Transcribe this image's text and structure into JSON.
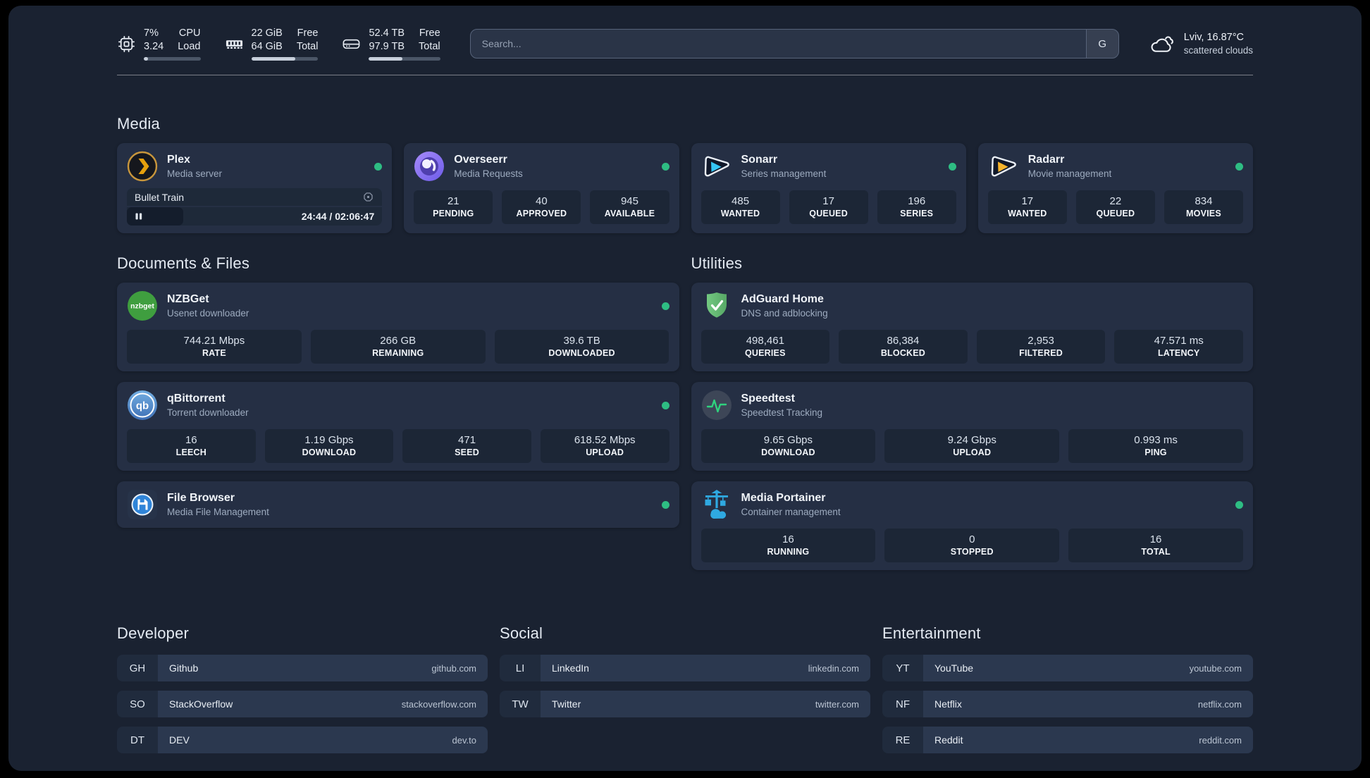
{
  "colors": {
    "status_online": "#2ebd83",
    "plex_orange": "#e5a00d",
    "sonarr_cyan": "#35c5f4",
    "radarr_amber": "#f7b42c",
    "speedtest_green": "#2fd27e",
    "portainer_blue": "#2fa9e1",
    "background": "#1a2231",
    "card": "#252f44"
  },
  "topbar": {
    "resources": [
      {
        "id": "cpu",
        "left_top": "7%",
        "left_bottom": "3.24",
        "right_top": "CPU",
        "right_bottom": "Load",
        "progress_pct": 7
      },
      {
        "id": "memory",
        "left_top": "22 GiB",
        "left_bottom": "64 GiB",
        "right_top": "Free",
        "right_bottom": "Total",
        "progress_pct": 66
      },
      {
        "id": "disk",
        "left_top": "52.4 TB",
        "left_bottom": "97.9 TB",
        "right_top": "Free",
        "right_bottom": "Total",
        "progress_pct": 47
      }
    ],
    "search": {
      "placeholder": "Search...",
      "button_label": "G"
    },
    "weather": {
      "location_temp": "Lviv, 16.87°C",
      "condition": "scattered clouds"
    }
  },
  "media": {
    "title": "Media",
    "cards": [
      {
        "name": "Plex",
        "desc": "Media server",
        "online": true,
        "player": {
          "title": "Bullet Train",
          "time_display": "24:44 / 02:06:47",
          "progress_pct": 22
        }
      },
      {
        "name": "Overseerr",
        "desc": "Media Requests",
        "online": true,
        "stats": [
          {
            "value": "21",
            "label": "PENDING"
          },
          {
            "value": "40",
            "label": "APPROVED"
          },
          {
            "value": "945",
            "label": "AVAILABLE"
          }
        ]
      },
      {
        "name": "Sonarr",
        "desc": "Series management",
        "online": true,
        "stats": [
          {
            "value": "485",
            "label": "WANTED"
          },
          {
            "value": "17",
            "label": "QUEUED"
          },
          {
            "value": "196",
            "label": "SERIES"
          }
        ]
      },
      {
        "name": "Radarr",
        "desc": "Movie management",
        "online": true,
        "stats": [
          {
            "value": "17",
            "label": "WANTED"
          },
          {
            "value": "22",
            "label": "QUEUED"
          },
          {
            "value": "834",
            "label": "MOVIES"
          }
        ]
      }
    ]
  },
  "documents": {
    "title": "Documents & Files",
    "cards": [
      {
        "name": "NZBGet",
        "desc": "Usenet downloader",
        "online": true,
        "stats": [
          {
            "value": "744.21 Mbps",
            "label": "RATE"
          },
          {
            "value": "266 GB",
            "label": "REMAINING"
          },
          {
            "value": "39.6 TB",
            "label": "DOWNLOADED"
          }
        ]
      },
      {
        "name": "qBittorrent",
        "desc": "Torrent downloader",
        "online": true,
        "stats": [
          {
            "value": "16",
            "label": "LEECH"
          },
          {
            "value": "1.19 Gbps",
            "label": "DOWNLOAD"
          },
          {
            "value": "471",
            "label": "SEED"
          },
          {
            "value": "618.52 Mbps",
            "label": "UPLOAD"
          }
        ]
      },
      {
        "name": "File Browser",
        "desc": "Media File Management",
        "online": true
      }
    ]
  },
  "utilities": {
    "title": "Utilities",
    "cards": [
      {
        "name": "AdGuard Home",
        "desc": "DNS and adblocking",
        "online": false,
        "stats": [
          {
            "value": "498,461",
            "label": "QUERIES"
          },
          {
            "value": "86,384",
            "label": "BLOCKED"
          },
          {
            "value": "2,953",
            "label": "FILTERED"
          },
          {
            "value": "47.571 ms",
            "label": "LATENCY"
          }
        ]
      },
      {
        "name": "Speedtest",
        "desc": "Speedtest Tracking",
        "online": false,
        "stats": [
          {
            "value": "9.65 Gbps",
            "label": "DOWNLOAD"
          },
          {
            "value": "9.24 Gbps",
            "label": "UPLOAD"
          },
          {
            "value": "0.993 ms",
            "label": "PING"
          }
        ]
      },
      {
        "name": "Media Portainer",
        "desc": "Container management",
        "online": true,
        "stats": [
          {
            "value": "16",
            "label": "RUNNING"
          },
          {
            "value": "0",
            "label": "STOPPED"
          },
          {
            "value": "16",
            "label": "TOTAL"
          }
        ]
      }
    ]
  },
  "bookmarks": {
    "groups": [
      {
        "title": "Developer",
        "items": [
          {
            "abbr": "GH",
            "name": "Github",
            "domain": "github.com"
          },
          {
            "abbr": "SO",
            "name": "StackOverflow",
            "domain": "stackoverflow.com"
          },
          {
            "abbr": "DT",
            "name": "DEV",
            "domain": "dev.to"
          }
        ]
      },
      {
        "title": "Social",
        "items": [
          {
            "abbr": "LI",
            "name": "LinkedIn",
            "domain": "linkedin.com"
          },
          {
            "abbr": "TW",
            "name": "Twitter",
            "domain": "twitter.com"
          }
        ]
      },
      {
        "title": "Entertainment",
        "items": [
          {
            "abbr": "YT",
            "name": "YouTube",
            "domain": "youtube.com"
          },
          {
            "abbr": "NF",
            "name": "Netflix",
            "domain": "netflix.com"
          },
          {
            "abbr": "RE",
            "name": "Reddit",
            "domain": "reddit.com"
          }
        ]
      }
    ]
  }
}
